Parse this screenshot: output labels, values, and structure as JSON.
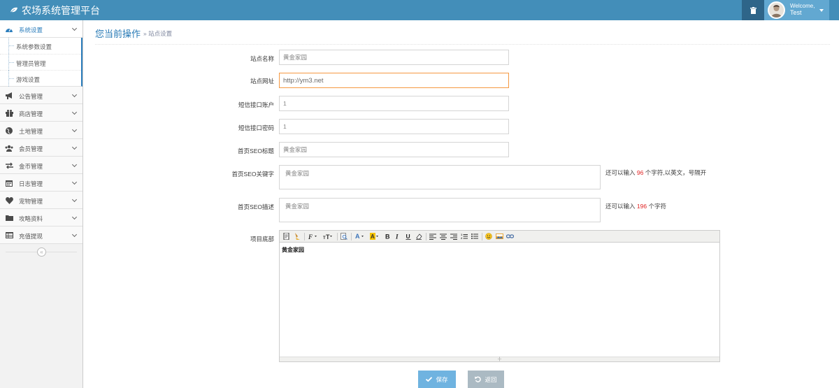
{
  "app": {
    "title": "农场系统管理平台"
  },
  "user": {
    "welcome": "Welcome,",
    "name": "Test"
  },
  "sidebar": {
    "items": [
      {
        "label": "系统设置",
        "icon": "dashboard-icon",
        "active": true,
        "children": [
          {
            "label": "系统参数设置"
          },
          {
            "label": "管理员管理"
          },
          {
            "label": "游戏设置"
          }
        ]
      },
      {
        "label": "公告管理",
        "icon": "bullhorn-icon"
      },
      {
        "label": "商店管理",
        "icon": "gift-icon"
      },
      {
        "label": "土地管理",
        "icon": "globe-icon"
      },
      {
        "label": "会员管理",
        "icon": "users-icon"
      },
      {
        "label": "金币管理",
        "icon": "exchange-icon"
      },
      {
        "label": "日志管理",
        "icon": "calendar-icon"
      },
      {
        "label": "宠物管理",
        "icon": "heart-icon"
      },
      {
        "label": "攻略资料",
        "icon": "folder-icon"
      },
      {
        "label": "充值提现",
        "icon": "list-icon"
      }
    ],
    "collapse_glyph": "«"
  },
  "header": {
    "title": "您当前操作",
    "breadcrumb": "» 站点设置"
  },
  "form": {
    "site_name": {
      "label": "站点名称",
      "value": "黄金家园"
    },
    "site_url": {
      "label": "站点网址",
      "value": "http://ym3.net"
    },
    "sms_account": {
      "label": "短信接口账户",
      "value": "1"
    },
    "sms_password": {
      "label": "短信接口密码",
      "value": "1"
    },
    "seo_title": {
      "label": "首页SEO标题",
      "value": "黄金家园"
    },
    "seo_keywords": {
      "label": "首页SEO关键字",
      "value": "黄金家园",
      "hint_prefix": "还可以输入",
      "hint_count": "96",
      "hint_suffix": "个字符,以英文，号隔开"
    },
    "seo_description": {
      "label": "首页SEO描述",
      "value": "黄金家园",
      "hint_prefix": "还可以输入",
      "hint_count": "196",
      "hint_suffix": "个字符"
    },
    "footer": {
      "label": "项目底部",
      "content": "黄金家园"
    }
  },
  "editor": {
    "foot_glyph": "-|-"
  },
  "buttons": {
    "save": "保存",
    "back": "返回"
  },
  "colors": {
    "navbar": "#438eb9",
    "accent": "#2679b5",
    "save": "#6fb3e0",
    "back": "#abbac3",
    "hint_number": "#e02222"
  }
}
